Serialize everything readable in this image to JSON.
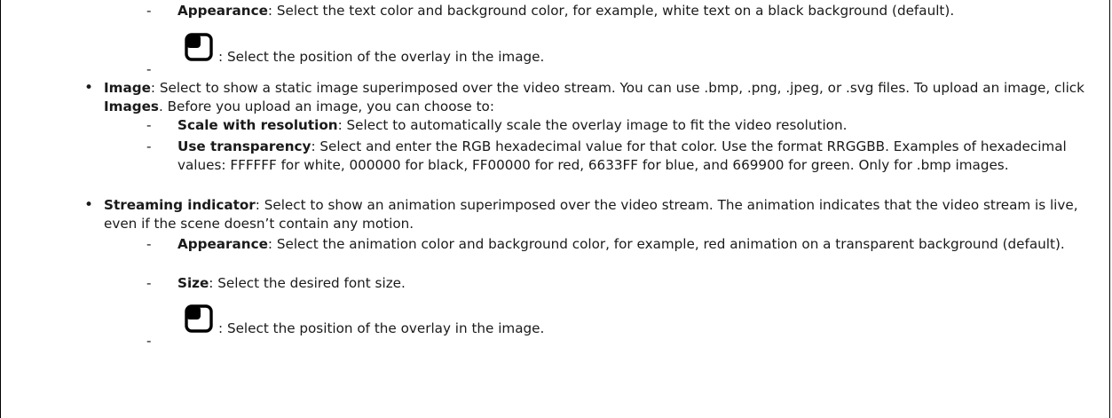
{
  "items": [
    {
      "kind": "dash",
      "bold": "Appearance",
      "text": ": Select the text color and background color, for example, white text on a black background (default)."
    },
    {
      "kind": "dash-icon",
      "icon": "overlay-position-icon",
      "text": ": Select the position of the overlay in the image."
    },
    {
      "kind": "bullet",
      "bold": "Image",
      "text": ": Select to show a static image superimposed over the video stream. You can use .bmp, .png, .jpeg, or .svg files. To upload an image, click ",
      "bold2": "Images",
      "text2": ". Before you upload an image, you can choose to:"
    },
    {
      "kind": "dash",
      "bold": "Scale with resolution",
      "text": ": Select to automatically scale the overlay image to fit the video resolution."
    },
    {
      "kind": "dash",
      "bold": "Use transparency",
      "text": ": Select and enter the RGB hexadecimal value for that color. Use the format RRGGBB. Examples of hexadecimal values: FFFFFF for white, 000000 for black, FF00000 for red, 6633FF for blue, and 669900 for green. Only for .bmp images."
    },
    {
      "kind": "bullet",
      "bold": "Streaming indicator",
      "text": ": Select to show an animation superimposed over the video stream. The animation indicates that the video stream is live, even if the scene doesn’t contain any motion."
    },
    {
      "kind": "dash",
      "bold": "Appearance",
      "text": ": Select the animation color and background color, for example, red animation on a transparent background (default)."
    },
    {
      "kind": "dash",
      "bold": "Size",
      "text": ": Select the desired font size."
    },
    {
      "kind": "dash-icon",
      "icon": "overlay-position-icon",
      "text": ": Select the position of the overlay in the image."
    }
  ],
  "glyphs": {
    "dash": "-",
    "bullet": "•"
  }
}
